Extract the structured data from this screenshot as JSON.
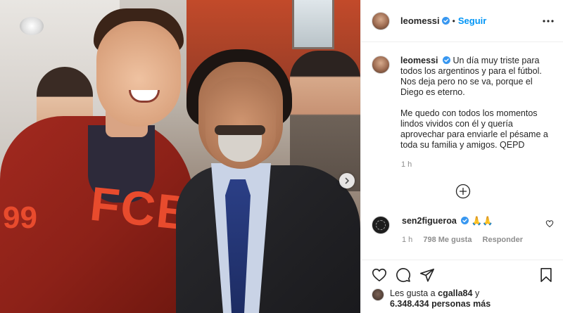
{
  "post": {
    "username": "leomessi",
    "follow_label": "Seguir",
    "dot": "•"
  },
  "caption": {
    "username": "leomessi",
    "text": "Un día muy triste para todos los argentinos y para el fútbol. Nos deja pero no se va, porque el Diego es eterno.\n\nMe quedo con todos los momentos lindos vividos con él y quería aprovechar para enviarle el pésame a toda su familia y amigos. QEPD",
    "time": "1 h"
  },
  "comment": {
    "username": "sen2figueroa",
    "text": "🙏🙏",
    "time": "1 h",
    "likes": "798 Me gusta",
    "reply_label": "Responder"
  },
  "likes": {
    "prefix": "Les gusta a",
    "user": "cgalla84",
    "joiner": "y",
    "others": "6.348.434 personas más"
  },
  "photo": {
    "hoodie_print": "FCB",
    "hoodie_number": "99"
  },
  "icons": {
    "verified": "verified-badge-icon",
    "more": "more-options-icon",
    "next": "chevron-right-icon",
    "load_more": "plus-circle-icon",
    "like": "heart-icon",
    "comment": "comment-icon",
    "share": "paper-plane-icon",
    "save": "bookmark-icon"
  },
  "colors": {
    "accent": "#0095f6",
    "text": "#262626",
    "muted": "#8e8e8e",
    "border": "#efefef"
  }
}
